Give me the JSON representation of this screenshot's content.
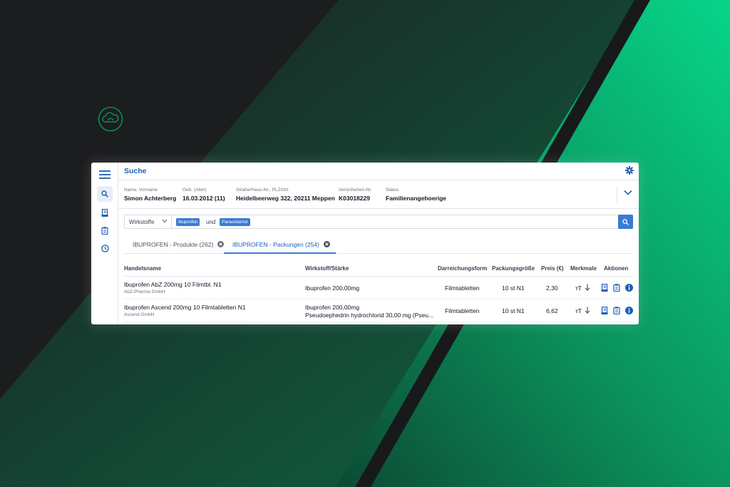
{
  "colors": {
    "accent": "#3a7bd5",
    "title": "#1a5fb4",
    "background_dark": "#1c1d1f",
    "background_green": "#07c47f"
  },
  "icons": {
    "logo": "cloud-logo-icon",
    "menu": "hamburger-menu-icon",
    "search": "search-icon",
    "book": "book-icon",
    "clipboard": "clipboard-icon",
    "clock": "clock-icon",
    "settings": "gear-icon",
    "expand": "chevron-down-icon",
    "info": "info-icon",
    "font": "font-size-icon",
    "arrow": "arrow-down-icon"
  },
  "header": {
    "title": "Suche"
  },
  "patient": {
    "name_label": "Name, Vorname",
    "name_value": "Simon Achterberg",
    "dob_label": "Geb. (Alter)",
    "dob_value": "16.03.2012 (11)",
    "address_label": "Straße/Haus-Nr., PLZ/Ort",
    "address_value": "Heidelbeerweg 322, 20211 Meppen",
    "insurance_label": "Versicherten-Nr.",
    "insurance_value": "K03018229",
    "status_label": "Status",
    "status_value": "Familienangehoerige"
  },
  "search": {
    "filter_selected": "Wirkstoffe",
    "chips": [
      "Ibuprofen",
      "Paracetamol"
    ],
    "connector": "und"
  },
  "tabs": [
    {
      "label": "IBUPROFEN - Produkte (262)"
    },
    {
      "label": "IBUPROFEN - Packungen (254)"
    }
  ],
  "table": {
    "columns": {
      "name": "Handelsname",
      "substance": "Wirkstoff/Stärke",
      "form": "Darreichungsform",
      "size": "Packungsgröße",
      "price": "Preis (€)",
      "features": "Merkmale",
      "actions": "Aktionen"
    },
    "rows": [
      {
        "name": "Ibuprofen AbZ 200mg 10 Filmtbl. N1",
        "maker": "AbZ-Pharma GmbH",
        "substance1": "Ibuprofen 200,00mg",
        "substance2": "",
        "form": "Filmtabletten",
        "size": "10 st N1",
        "price": "2,30"
      },
      {
        "name": "Ibuprofen Ascend 200mg 10 Filmtabletten N1",
        "maker": "Ascend GmbH",
        "substance1": "Ibuprofen 200,00mg",
        "substance2": "Pseudoephedrin hydrochlorid 30,00 mg (Pseu...",
        "form": "Filmtabletten",
        "size": "10 st N1",
        "price": "6,62"
      }
    ]
  }
}
